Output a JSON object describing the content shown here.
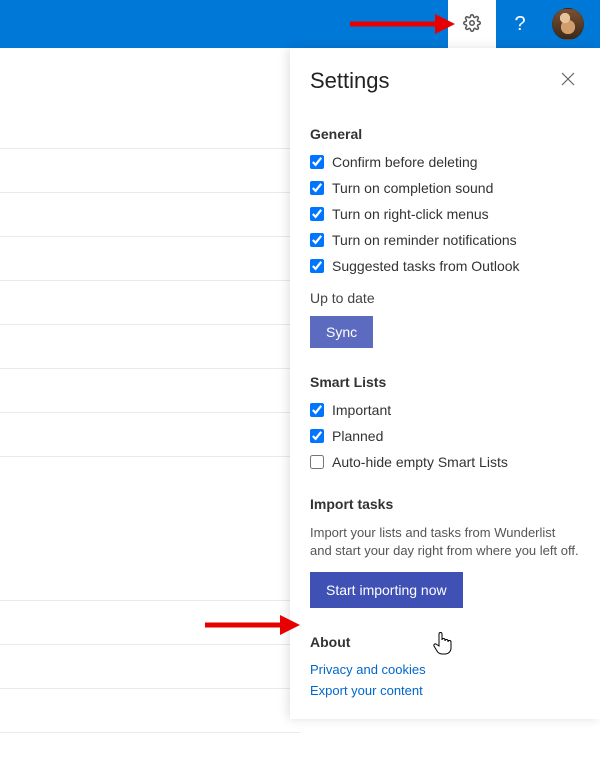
{
  "header": {
    "gear_tooltip": "Settings",
    "help_label": "?",
    "avatar_alt": "User avatar"
  },
  "panel": {
    "title": "Settings"
  },
  "general": {
    "title": "General",
    "items": [
      {
        "label": "Confirm before deleting",
        "checked": true
      },
      {
        "label": "Turn on completion sound",
        "checked": true
      },
      {
        "label": "Turn on right-click menus",
        "checked": true
      },
      {
        "label": "Turn on reminder notifications",
        "checked": true
      },
      {
        "label": "Suggested tasks from Outlook",
        "checked": true
      }
    ],
    "status": "Up to date",
    "sync_label": "Sync"
  },
  "smart_lists": {
    "title": "Smart Lists",
    "items": [
      {
        "label": "Important",
        "checked": true
      },
      {
        "label": "Planned",
        "checked": true
      },
      {
        "label": "Auto-hide empty Smart Lists",
        "checked": false
      }
    ]
  },
  "import": {
    "title": "Import tasks",
    "desc": "Import your lists and tasks from Wunderlist and start your day right from where you left off.",
    "button_label": "Start importing now"
  },
  "about": {
    "title": "About",
    "links": [
      "Privacy and cookies",
      "Export your content"
    ]
  }
}
